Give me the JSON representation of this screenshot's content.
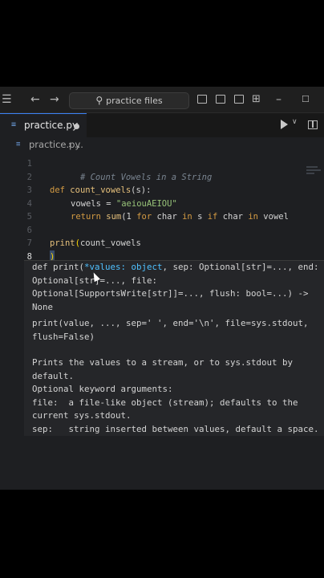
{
  "titlebar": {
    "menu_icon": "menu-icon",
    "back_icon": "arrow-left-icon",
    "forward_icon": "arrow-right-icon",
    "search_placeholder": "practice files",
    "minimize_icon": "minimize-icon",
    "maximize_icon": "maximize-icon"
  },
  "tab": {
    "label": "practice.py",
    "modified_indicator": "dot"
  },
  "breadcrumb": {
    "file": "practice.py",
    "separator": "›",
    "more": "..."
  },
  "editor": {
    "line_numbers": [
      "1",
      "2",
      "3",
      "4",
      "5",
      "6",
      "7",
      "8"
    ],
    "active_line": "8",
    "lines": {
      "l1_comment": "# Count Vowels in a String",
      "l3_def": "def",
      "l3_name": "count_vowels",
      "l3_rest": "(s):",
      "l4_var": "vowels = ",
      "l4_str": "\"aeiouAEIOU\"",
      "l5_return": "return",
      "l5_sum": "sum",
      "l5_rest_a": "(1 ",
      "l5_for": "for",
      "l5_rest_b": " char ",
      "l5_in": "in",
      "l5_rest_c": " s ",
      "l5_if": "if",
      "l5_rest_d": " char ",
      "l5_in2": "in",
      "l5_rest_e": " vowel",
      "l7_print": "print",
      "l7_paren": "(",
      "l7_arg": "count_vowels",
      "l8_paren": ")"
    }
  },
  "tooltip": {
    "sig1_a": "def print(",
    "sig1_b": "*values: object",
    "sig1_c": ", sep: Optional[str]=..., end:",
    "sig2": "Optional[str]=..., file:",
    "sig3": "Optional[SupportsWrite[str]]=..., flush: bool=...) ->",
    "sig4": "None",
    "usage1": "print(value, ..., sep=' ', end='\\n', file=sys.stdout,",
    "usage2": "flush=False)",
    "doc1": "Prints the values to a stream, or to sys.stdout by",
    "doc2": "default.",
    "doc3": "Optional keyword arguments:",
    "doc4": "file:  a file-like object (stream); defaults to the",
    "doc5": "current sys.stdout.",
    "doc6": "sep:   string inserted between values, default a space."
  },
  "colors": {
    "background": "#1e1f22",
    "accent": "#3b82f6",
    "keyword": "#d49b43",
    "function": "#e6c07b",
    "string": "#98c379",
    "comment": "#7a8591",
    "builtin": "#4fc1ff"
  }
}
